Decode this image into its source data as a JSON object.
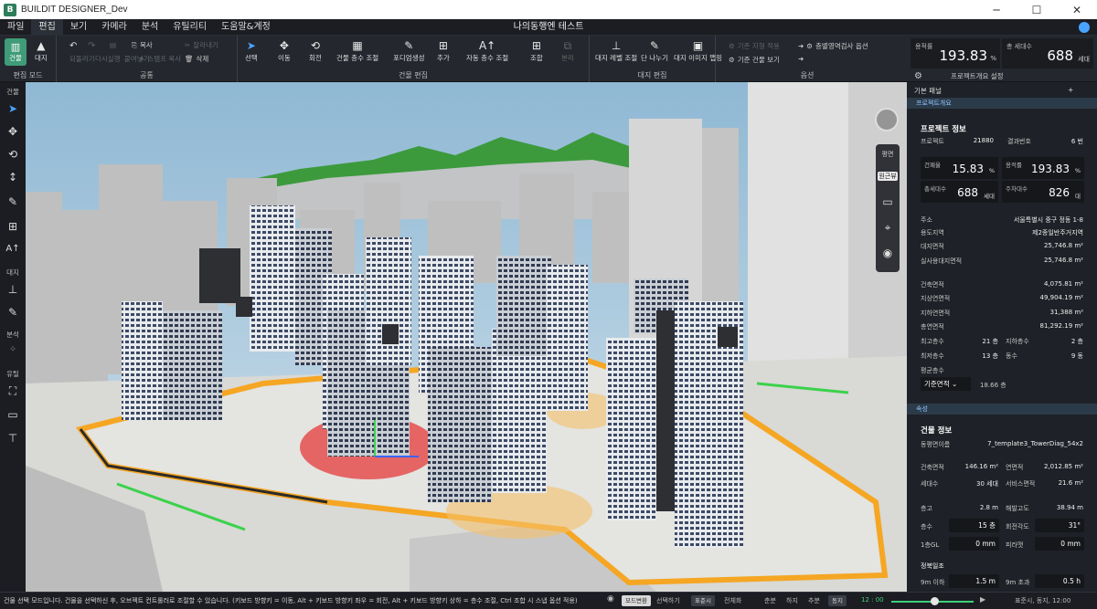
{
  "window": {
    "title": "BUILDIT DESIGNER_Dev",
    "logo_letter": "B"
  },
  "menu": {
    "items": [
      "파일",
      "편집",
      "보기",
      "카메라",
      "분석",
      "유틸리티",
      "도움말&계정"
    ],
    "doc_title": "나의동행엔 테스트"
  },
  "ribbon": {
    "mode": {
      "build_label": "건물",
      "site_label": "대지",
      "group_label": "편집 모드"
    },
    "common": {
      "undo": "되돌리기",
      "redo": "다시실행",
      "paste": "붙여넣기",
      "copy": "복사",
      "stamp": "스탬프 복사",
      "cut": "잘라내기",
      "delete": "삭제",
      "group_label": "공통"
    },
    "building_edit": {
      "select": "선택",
      "move": "이동",
      "rotate": "회전",
      "floors": "건물 층수 조절",
      "pilotis": "포디엄생성",
      "add": "추가",
      "auto_floors": "자동 층수 조절",
      "combine": "조합",
      "split": "분리",
      "group_label": "건물 편집"
    },
    "site_edit": {
      "level": "대지 레벨 조절",
      "cut": "단 나누기",
      "image": "대지 이미지 맵핑",
      "group_label": "대지 편집"
    },
    "options": {
      "base_view": "기준 건물 보기",
      "opt1": "기존 지형 적용",
      "opt2": "층별영역검사 옵션",
      "group_label": "옵션"
    }
  },
  "metrics": {
    "far_label": "용적률",
    "far_value": "193.83",
    "far_unit": "%",
    "units_label": "총 세대수",
    "units_value": "688",
    "units_unit": "세대",
    "settings_label": "프로젝트개요 설정"
  },
  "leftbar": {
    "sections": [
      "건물",
      "대지",
      "분석",
      "유틸"
    ]
  },
  "viewtools": {
    "btn1": "평면",
    "btn2": "원근뷰"
  },
  "panel": {
    "title": "기본 패널",
    "section1": "프로젝트개요",
    "project_title": "프로젝트 정보",
    "project_id_label": "프로젝트",
    "project_id": "21880",
    "result_label": "결과번호",
    "result": "6 번",
    "bcr_label": "건폐율",
    "bcr": "15.83",
    "bcr_unit": "%",
    "far_label": "용적률",
    "far": "193.83",
    "far_unit": "%",
    "units_label": "총세대수",
    "units": "688",
    "units_unit": "세대",
    "parking_label": "주차대수",
    "parking": "826",
    "parking_unit": "대",
    "address_label": "주소",
    "address": "서울특별시 중구 정동 1-8",
    "zone_label": "용도지역",
    "zone": "제2종일반주거지역",
    "site_area_label": "대지면적",
    "site_area": "25,746.8 m²",
    "real_site_label": "실사용대지면적",
    "real_site": "25,746.8 m²",
    "bldg_area_label": "건축면적",
    "bldg_area": "4,075.81 m²",
    "above_label": "지상연면적",
    "above": "49,904.19 m²",
    "below_label": "지하연면적",
    "below": "31,388 m²",
    "total_label": "총연면적",
    "total": "81,292.19 m²",
    "max_floor_label": "최고층수",
    "max_floor": "21 층",
    "basement_label": "지하층수",
    "basement": "2 층",
    "min_floor_label": "최저층수",
    "min_floor": "13 층",
    "blocks_label": "동수",
    "blocks": "9 동",
    "avg_label": "평균층수",
    "avg_select": "기준면적",
    "avg_value": "18.66 층",
    "section2": "속성",
    "bldg_title": "건물 정보",
    "type_label": "동평면이름",
    "type": "7_template3_TowerDiag_54x2",
    "b_area_label": "건축면적",
    "b_area": "146.16 m²",
    "g_area_label": "연면적",
    "g_area": "2,012.85 m²",
    "hh_label": "세대수",
    "hh": "30 세대",
    "svc_label": "서비스면적",
    "svc": "21.6 m²",
    "fh_label": "층고",
    "fh": "2.8 m",
    "alt_label": "해발고도",
    "alt": "38.94 m",
    "floors_label": "층수",
    "floors": "15 층",
    "rot_label": "회전각도",
    "rot": "31°",
    "gl_label": "1층GL",
    "gl": "0 mm",
    "pilot_label": "피라맷",
    "pilot": "0 mm",
    "sunlight_label": "정북일조",
    "s1_label": "9m 이하",
    "s1": "1.5 m",
    "s2_label": "9m 초과",
    "s2": "0.5 h"
  },
  "status": {
    "message": "건물 선택 모드입니다. 건물을 선택하신 후, 오브젝트 컨트롤러로 조절할 수 있습니다. (키보드 방향키 = 이동, Alt + 키보드 방향키 좌우 = 회전, Alt + 키보드 방향키 상하 = 층수 조절, Ctrl 조합 시 스냅 옵션 적용)",
    "pills": [
      "모드변환",
      "선택하기",
      "표준시",
      "전체화",
      "춘분",
      "하지",
      "추분",
      "동지"
    ],
    "time": "12 : 00",
    "date": "표준시, 동지, 12:00"
  },
  "colors": {
    "accent": "#3f9b78",
    "highlight": "#4aa3ff",
    "buffer": "#f5a623",
    "sky": "#9fc4dc"
  }
}
